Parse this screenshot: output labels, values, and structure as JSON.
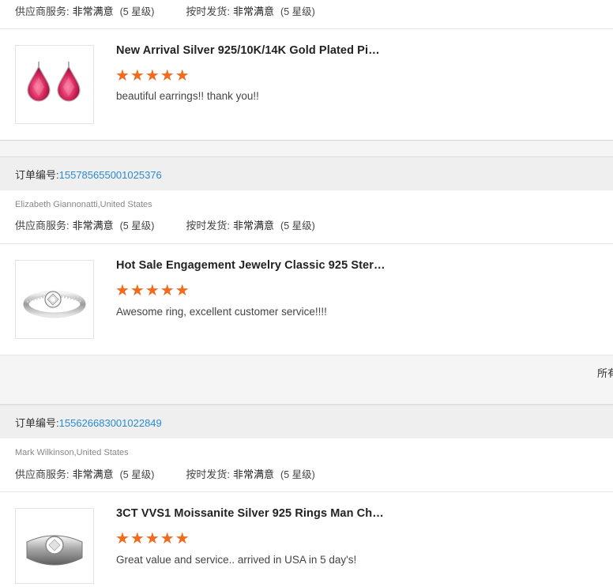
{
  "rating_labels": {
    "supplier_service": "供应商服务:",
    "on_time_delivery": "按时发货:",
    "very_satisfied": "非常满意",
    "five_star": "(5 星级)"
  },
  "order_label": "订单编号:",
  "truncated_right_text": "所有",
  "reviews": [
    {
      "order_number": "",
      "buyer": "",
      "product_title": "New Arrival Silver 925/10K/14K Gold Plated Pi…",
      "stars": "★★★★★",
      "comment": "beautiful earrings!! thank you!!",
      "image": "pink-pear-earrings-image"
    },
    {
      "order_number": "155785655001025376",
      "buyer": "Elizabeth Giannonatti,United States",
      "product_title": "Hot Sale Engagement Jewelry Classic 925 Ster…",
      "stars": "★★★★★",
      "comment": "Awesome ring, excellent customer service!!!!",
      "image": "engagement-ring-image"
    },
    {
      "order_number": "155626683001022849",
      "buyer": "Mark Wilkinson,United States",
      "product_title": "3CT VVS1 Moissanite Silver 925 Rings Man Ch…",
      "stars": "★★★★★",
      "comment": "Great value and service.. arrived in USA in 5 day's!",
      "image": "mens-band-ring-image"
    }
  ],
  "colors": {
    "accent_link": "#2a8bd0",
    "star": "#f26a1b",
    "band": "#f5f5f5"
  }
}
